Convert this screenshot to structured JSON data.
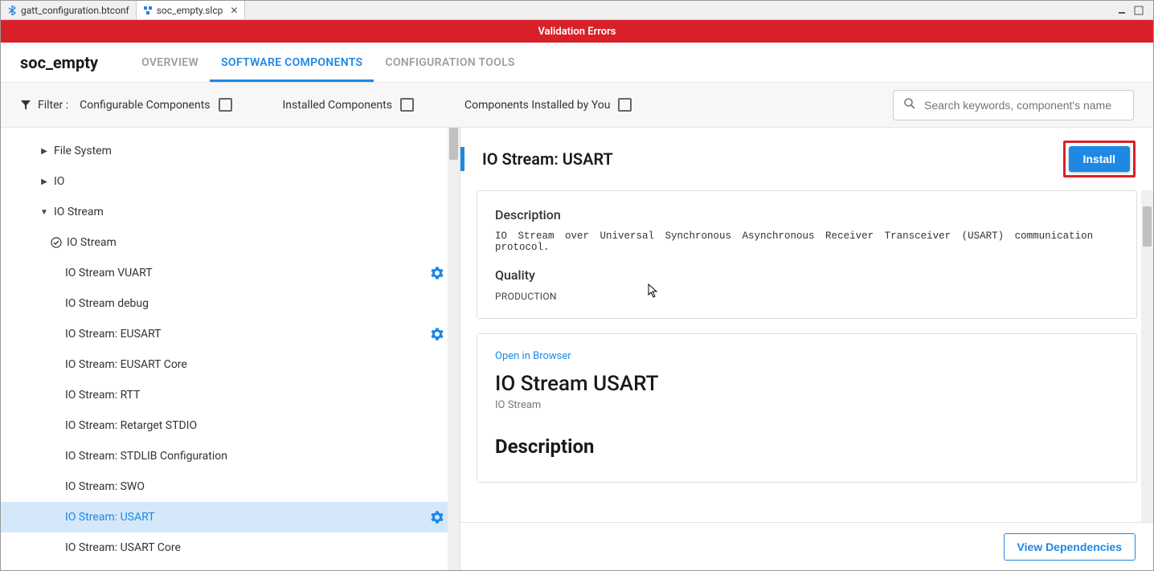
{
  "tabs": {
    "gatt": "gatt_configuration.btconf",
    "slcp": "soc_empty.slcp"
  },
  "banner": "Validation Errors",
  "project": "soc_empty",
  "nav": {
    "overview": "OVERVIEW",
    "software": "SOFTWARE COMPONENTS",
    "config": "CONFIGURATION TOOLS"
  },
  "filter": {
    "label": "Filter :",
    "configurable": "Configurable Components",
    "installed": "Installed Components",
    "by_you": "Components Installed by You"
  },
  "search": {
    "placeholder": "Search keywords, component's name"
  },
  "tree": {
    "fs": "File System",
    "io": "IO",
    "io_stream": "IO Stream",
    "io_stream_sub": "IO Stream",
    "vuart": "IO Stream VUART",
    "debug": "IO Stream debug",
    "eusart": "IO Stream: EUSART",
    "eusart_core": "IO Stream: EUSART Core",
    "rtt": "IO Stream: RTT",
    "retarget": "IO Stream: Retarget STDIO",
    "stdlib": "IO Stream: STDLIB Configuration",
    "swo": "IO Stream: SWO",
    "usart": "IO Stream: USART",
    "usart_core": "IO Stream: USART Core"
  },
  "detail": {
    "title": "IO Stream: USART",
    "install": "Install",
    "desc_h": "Description",
    "desc_txt": "IO Stream over Universal Synchronous Asynchronous Receiver Transceiver (USART) communication protocol.",
    "quality_h": "Quality",
    "quality_v": "PRODUCTION",
    "open": "Open in Browser",
    "big_title": "IO Stream USART",
    "sub": "IO Stream",
    "big_desc": "Description",
    "view_dep": "View Dependencies"
  }
}
